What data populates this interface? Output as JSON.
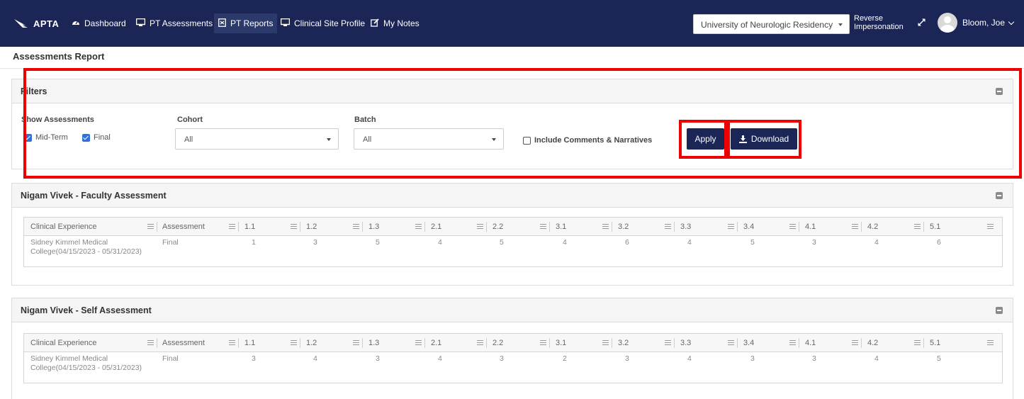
{
  "nav": {
    "logo": "APTA",
    "items": [
      {
        "label": "Dashboard",
        "icon": "dashboard-icon"
      },
      {
        "label": "PT Assessments",
        "icon": "monitor-icon"
      },
      {
        "label": "PT Reports",
        "icon": "report-icon",
        "active": true
      },
      {
        "label": "Clinical Site Profile",
        "icon": "monitor-icon"
      },
      {
        "label": "My Notes",
        "icon": "edit-icon"
      }
    ],
    "institution": "University of Neurologic Residency",
    "reverse_line1": "Reverse",
    "reverse_line2": "Impersonation",
    "user": "Bloom, Joe"
  },
  "page": {
    "title": "Assessments Report"
  },
  "filters": {
    "title": "Filters",
    "show_label": "Show Assessments",
    "midterm": "Mid-Term",
    "final": "Final",
    "cohort_label": "Cohort",
    "cohort_value": "All",
    "batch_label": "Batch",
    "batch_value": "All",
    "include_comments": "Include Comments & Narratives",
    "apply": "Apply",
    "download": "Download"
  },
  "tables": [
    {
      "title": "Nigam Vivek - Faculty Assessment",
      "columns": [
        "Clinical Experience",
        "Assessment",
        "1.1",
        "1.2",
        "1.3",
        "2.1",
        "2.2",
        "3.1",
        "3.2",
        "3.3",
        "3.4",
        "4.1",
        "4.2",
        "5.1"
      ],
      "row": {
        "experience_line1": "Sidney Kimmel Medical",
        "experience_line2": "College(04/15/2023 - 05/31/2023)",
        "assessment": "Final",
        "scores": [
          "1",
          "3",
          "5",
          "4",
          "5",
          "4",
          "6",
          "4",
          "5",
          "3",
          "4",
          "6"
        ]
      }
    },
    {
      "title": "Nigam Vivek - Self Assessment",
      "columns": [
        "Clinical Experience",
        "Assessment",
        "1.1",
        "1.2",
        "1.3",
        "2.1",
        "2.2",
        "3.1",
        "3.2",
        "3.3",
        "3.4",
        "4.1",
        "4.2",
        "5.1"
      ],
      "row": {
        "experience_line1": "Sidney Kimmel Medical",
        "experience_line2": "College(04/15/2023 - 05/31/2023)",
        "assessment": "Final",
        "scores": [
          "3",
          "4",
          "3",
          "4",
          "3",
          "2",
          "3",
          "4",
          "3",
          "3",
          "4",
          "5"
        ]
      }
    }
  ]
}
